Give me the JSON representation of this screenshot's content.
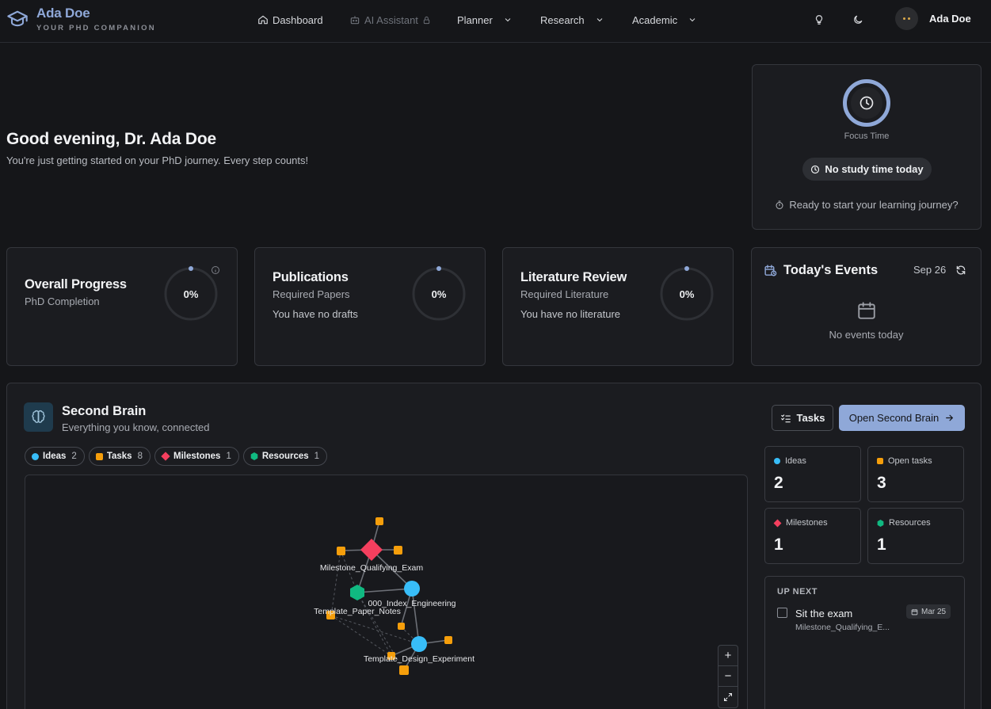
{
  "brand": {
    "name": "Ada Doe",
    "tagline": "YOUR PHD COMPANION"
  },
  "nav": {
    "dashboard": "Dashboard",
    "ai_assistant": "AI Assistant",
    "planner": "Planner",
    "research": "Research",
    "academic": "Academic"
  },
  "user": {
    "name": "Ada Doe"
  },
  "greeting": {
    "title": "Good evening, Dr. Ada Doe",
    "subtitle": "You're just getting started on your PhD journey. Every step counts!"
  },
  "focus": {
    "label": "Focus Time",
    "status": "No study time today",
    "prompt": "Ready to start your learning journey?"
  },
  "stats": [
    {
      "title": "Overall Progress",
      "subtitle": "PhD Completion",
      "note": "",
      "value": "0%",
      "progress": 0
    },
    {
      "title": "Publications",
      "subtitle": "Required Papers",
      "note": "You have no drafts",
      "value": "0%",
      "progress": 0
    },
    {
      "title": "Literature Review",
      "subtitle": "Required Literature",
      "note": "You have no literature",
      "value": "0%",
      "progress": 0
    }
  ],
  "events": {
    "title": "Today's Events",
    "date": "Sep 26",
    "empty": "No events today"
  },
  "brain": {
    "title": "Second Brain",
    "subtitle": "Everything you know, connected",
    "tasks_button": "Tasks",
    "open_button": "Open Second Brain",
    "filters": [
      {
        "label": "Ideas",
        "count": "2",
        "color": "#38bdf8"
      },
      {
        "label": "Tasks",
        "count": "8",
        "color": "#f59e0b"
      },
      {
        "label": "Milestones",
        "count": "1",
        "color": "#f43f5e"
      },
      {
        "label": "Resources",
        "count": "1",
        "color": "#10b981"
      }
    ],
    "graph_labels": {
      "milestone": "Milestone_Qualifying_Exam",
      "index": "000_Index_Engineering",
      "paper_notes": "Template_Paper_Notes",
      "design_experiment": "Template_Design_Experiment"
    },
    "zoom": {
      "in": "+",
      "out": "−"
    },
    "summary": [
      {
        "label": "Ideas",
        "value": "2",
        "color": "#38bdf8"
      },
      {
        "label": "Open tasks",
        "value": "3",
        "color": "#f59e0b"
      },
      {
        "label": "Milestones",
        "value": "1",
        "color": "#f43f5e"
      },
      {
        "label": "Resources",
        "value": "1",
        "color": "#10b981"
      }
    ],
    "up_next": {
      "title": "UP NEXT",
      "task": "Sit the exam",
      "source": "Milestone_Qualifying_E...",
      "date": "Mar 25"
    }
  }
}
